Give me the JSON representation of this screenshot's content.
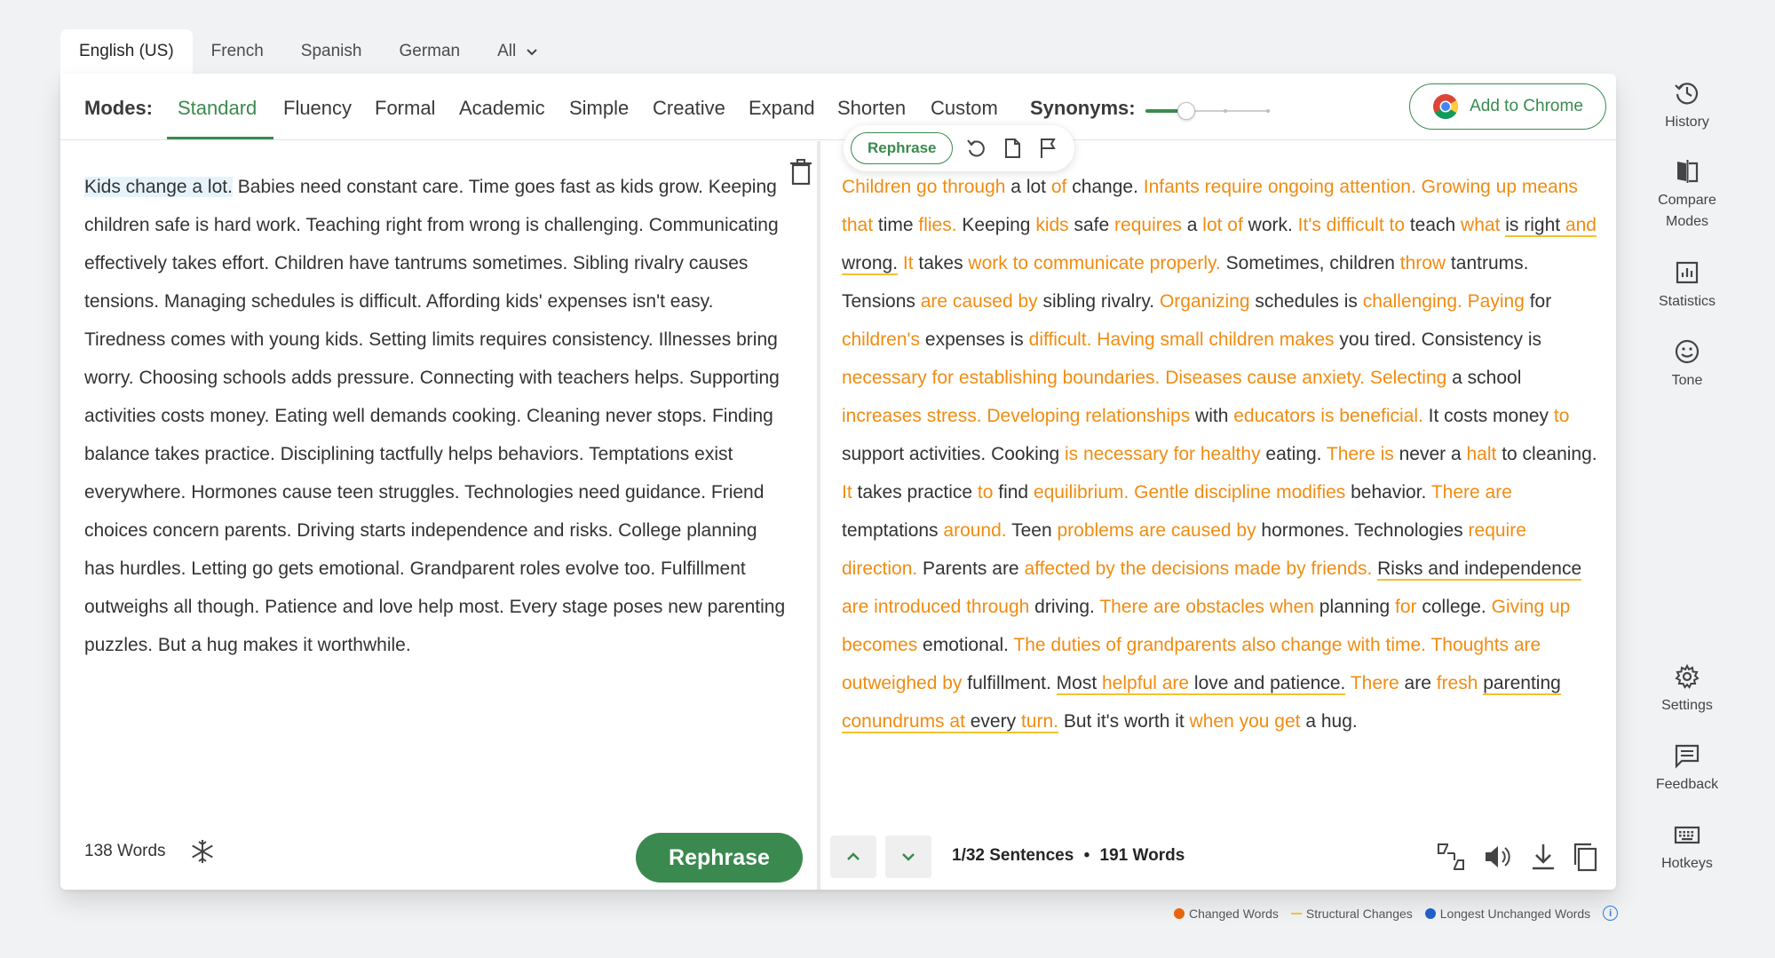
{
  "languages": {
    "tabs": [
      "English (US)",
      "French",
      "Spanish",
      "German"
    ],
    "all_label": "All"
  },
  "modes": {
    "label": "Modes:",
    "items": [
      "Standard",
      "Fluency",
      "Formal",
      "Academic",
      "Simple",
      "Creative",
      "Expand",
      "Shorten",
      "Custom"
    ],
    "active": "Standard",
    "synonyms_label": "Synonyms:",
    "synonyms_level_fraction": 0.33,
    "chrome_button": "Add to Chrome"
  },
  "colors": {
    "accent": "#3a8a4f",
    "changed": "#f08c12",
    "structural": "#f2c230",
    "unchanged": "#2c7bdc"
  },
  "input": {
    "highlight": "Kids change a lot.",
    "text": " Babies need constant care. Time goes fast as kids grow. Keeping children safe is hard work. Teaching right from wrong is challenging. Communicating effectively takes effort. Children have tantrums sometimes. Sibling rivalry causes tensions. Managing schedules is difficult. Affording kids' expenses isn't easy. Tiredness comes with young kids. Setting limits requires consistency. Illnesses bring worry. Choosing schools adds pressure. Connecting with teachers helps. Supporting activities costs money. Eating well demands cooking. Cleaning never stops. Finding balance takes practice. Disciplining tactfully helps behaviors. Temptations exist everywhere. Hormones cause teen struggles. Technologies need guidance. Friend choices concern parents. Driving starts independence and risks. College planning has hurdles. Letting go gets emotional. Grandparent roles evolve too. Fulfillment outweighs all though. Patience and love help most. Every stage poses new parenting puzzles. But a hug makes it worthwhile.",
    "word_count": "138 Words",
    "rephrase_button": "Rephrase"
  },
  "popup": {
    "rephrase_label": "Rephrase"
  },
  "output": {
    "segments": [
      {
        "t": "Children go through",
        "k": "c"
      },
      {
        "t": " a lot ",
        "k": "n"
      },
      {
        "t": "of",
        "k": "c"
      },
      {
        "t": " change. ",
        "k": "n"
      },
      {
        "t": "Infants require ongoing attention. Growing up means that",
        "k": "c"
      },
      {
        "t": " time ",
        "k": "n"
      },
      {
        "t": "flies.",
        "k": "c"
      },
      {
        "t": " Keeping ",
        "k": "n"
      },
      {
        "t": "kids",
        "k": "c"
      },
      {
        "t": " safe ",
        "k": "n"
      },
      {
        "t": "requires",
        "k": "c"
      },
      {
        "t": " a ",
        "k": "n"
      },
      {
        "t": "lot of",
        "k": "c"
      },
      {
        "t": " work. ",
        "k": "n"
      },
      {
        "t": "It's difficult to",
        "k": "c"
      },
      {
        "t": " teach ",
        "k": "n"
      },
      {
        "t": "what",
        "k": "c"
      },
      {
        "t": " ",
        "k": "n"
      },
      {
        "t": "is right ",
        "k": "s"
      },
      {
        "t": "and",
        "k": "cs"
      },
      {
        "t": " wrong.",
        "k": "s"
      },
      {
        "t": " ",
        "k": "n"
      },
      {
        "t": "It",
        "k": "c"
      },
      {
        "t": " takes ",
        "k": "n"
      },
      {
        "t": "work to communicate properly.",
        "k": "c"
      },
      {
        "t": " Sometimes, children ",
        "k": "n"
      },
      {
        "t": "throw",
        "k": "c"
      },
      {
        "t": " tantrums. Tensions ",
        "k": "n"
      },
      {
        "t": "are caused by",
        "k": "c"
      },
      {
        "t": " sibling rivalry. ",
        "k": "n"
      },
      {
        "t": "Organizing",
        "k": "c"
      },
      {
        "t": " schedules is ",
        "k": "n"
      },
      {
        "t": "challenging. Paying",
        "k": "c"
      },
      {
        "t": " for ",
        "k": "n"
      },
      {
        "t": "children's",
        "k": "c"
      },
      {
        "t": " expenses is ",
        "k": "n"
      },
      {
        "t": "difficult. Having small children makes",
        "k": "c"
      },
      {
        "t": " you tired. Consistency is ",
        "k": "n"
      },
      {
        "t": "necessary for establishing boundaries. Diseases cause anxiety. Selecting",
        "k": "c"
      },
      {
        "t": " a school ",
        "k": "n"
      },
      {
        "t": "increases stress. Developing relationships",
        "k": "c"
      },
      {
        "t": " with ",
        "k": "n"
      },
      {
        "t": "educators is beneficial.",
        "k": "c"
      },
      {
        "t": " It costs money ",
        "k": "n"
      },
      {
        "t": "to",
        "k": "c"
      },
      {
        "t": " support activities. Cooking ",
        "k": "n"
      },
      {
        "t": "is necessary for healthy",
        "k": "c"
      },
      {
        "t": " eating. ",
        "k": "n"
      },
      {
        "t": "There is",
        "k": "c"
      },
      {
        "t": " never a ",
        "k": "n"
      },
      {
        "t": "halt",
        "k": "c"
      },
      {
        "t": " to cleaning. ",
        "k": "n"
      },
      {
        "t": "It",
        "k": "c"
      },
      {
        "t": " takes practice ",
        "k": "n"
      },
      {
        "t": "to",
        "k": "c"
      },
      {
        "t": " find ",
        "k": "n"
      },
      {
        "t": "equilibrium. Gentle discipline modifies",
        "k": "c"
      },
      {
        "t": " behavior. ",
        "k": "n"
      },
      {
        "t": "There are",
        "k": "c"
      },
      {
        "t": " temptations ",
        "k": "n"
      },
      {
        "t": "around.",
        "k": "c"
      },
      {
        "t": " Teen ",
        "k": "n"
      },
      {
        "t": "problems are caused by",
        "k": "c"
      },
      {
        "t": " hormones. Technologies ",
        "k": "n"
      },
      {
        "t": "require direction.",
        "k": "c"
      },
      {
        "t": " Parents are ",
        "k": "n"
      },
      {
        "t": "affected by the decisions made by friends.",
        "k": "c"
      },
      {
        "t": " ",
        "k": "n"
      },
      {
        "t": "Risks and independence",
        "k": "s"
      },
      {
        "t": " ",
        "k": "n"
      },
      {
        "t": "are introduced through",
        "k": "c"
      },
      {
        "t": " driving. ",
        "k": "n"
      },
      {
        "t": "There are obstacles when",
        "k": "c"
      },
      {
        "t": " planning ",
        "k": "n"
      },
      {
        "t": "for",
        "k": "c"
      },
      {
        "t": " college. ",
        "k": "n"
      },
      {
        "t": "Giving up becomes",
        "k": "c"
      },
      {
        "t": " emotional. ",
        "k": "n"
      },
      {
        "t": "The duties of grandparents also change with time. Thoughts are outweighed by",
        "k": "c"
      },
      {
        "t": " fulfillment. ",
        "k": "n"
      },
      {
        "t": "Most ",
        "k": "s"
      },
      {
        "t": "helpful are",
        "k": "cs"
      },
      {
        "t": " love and patience.",
        "k": "s"
      },
      {
        "t": " ",
        "k": "n"
      },
      {
        "t": "There",
        "k": "c"
      },
      {
        "t": " are ",
        "k": "n"
      },
      {
        "t": "fresh",
        "k": "c"
      },
      {
        "t": " ",
        "k": "n"
      },
      {
        "t": "parenting ",
        "k": "s"
      },
      {
        "t": "conundrums at",
        "k": "cs"
      },
      {
        "t": " every ",
        "k": "s"
      },
      {
        "t": "turn.",
        "k": "cs"
      },
      {
        "t": " But it's worth it ",
        "k": "n"
      },
      {
        "t": "when you get",
        "k": "c"
      },
      {
        "t": " a hug.",
        "k": "n"
      }
    ],
    "sentence_info": "1/32 Sentences",
    "separator": "•",
    "word_count": "191 Words"
  },
  "legend": {
    "changed": "Changed Words",
    "structural": "Structural Changes",
    "unchanged": "Longest Unchanged Words",
    "info_glyph": "i"
  },
  "sidebar": {
    "top": [
      {
        "label": "History",
        "icon": "history-icon"
      },
      {
        "label": "Compare Modes",
        "icon": "compare-icon"
      },
      {
        "label": "Statistics",
        "icon": "statistics-icon"
      },
      {
        "label": "Tone",
        "icon": "tone-icon"
      }
    ],
    "bottom": [
      {
        "label": "Settings",
        "icon": "gear-icon"
      },
      {
        "label": "Feedback",
        "icon": "feedback-icon"
      },
      {
        "label": "Hotkeys",
        "icon": "keyboard-icon"
      }
    ]
  }
}
